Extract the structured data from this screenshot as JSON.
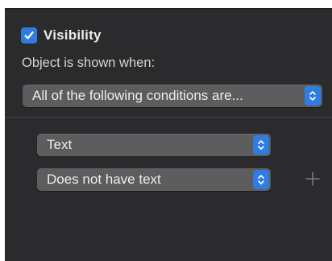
{
  "visibility": {
    "checked": true,
    "label": "Visibility"
  },
  "shown_when_label": "Object is shown when:",
  "condition_mode": {
    "selected": "All of the following conditions are..."
  },
  "rule": {
    "field": {
      "selected": "Text"
    },
    "operator": {
      "selected": "Does not have text"
    },
    "add_icon": "plus-icon"
  },
  "colors": {
    "panel_bg": "#2b2a2c",
    "accent": "#2f7de1",
    "popup_bg": "#5d5c5e",
    "text": "#eeeeee"
  }
}
